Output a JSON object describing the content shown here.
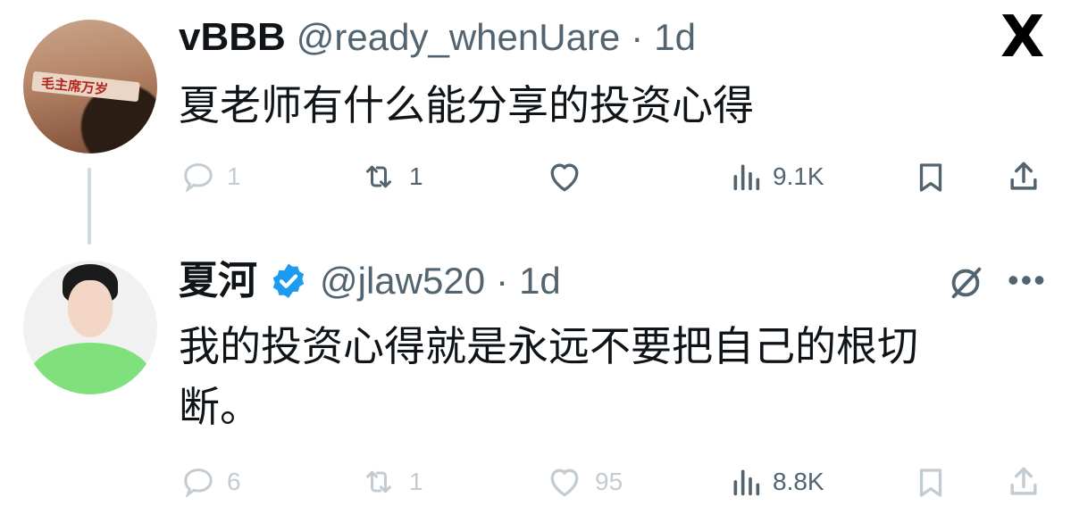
{
  "header": {
    "logo_label": "X"
  },
  "tweets": [
    {
      "name": "vBBB",
      "handle": "@ready_whenUare",
      "time": "1d",
      "avatar_banner_text": "毛主席万岁",
      "text": "夏老师有什么能分享的投资心得",
      "actions": {
        "replies": "1",
        "reposts": "1",
        "likes": "",
        "views": "9.1K"
      },
      "icons": [
        "reply-icon",
        "repost-icon",
        "like-icon",
        "views-icon",
        "bookmark-icon",
        "share-icon"
      ]
    },
    {
      "name": "夏河",
      "handle": "@jlaw520",
      "time": "1d",
      "verified": true,
      "text_line1": "我的投资心得就是永远不要把自己的根切",
      "text_line2": "断。",
      "actions": {
        "replies": "6",
        "reposts": "1",
        "likes": "95",
        "views": "8.8K"
      },
      "icons": [
        "grok-icon",
        "more-icon",
        "reply-icon",
        "repost-icon",
        "like-icon",
        "views-icon",
        "bookmark-icon",
        "share-icon"
      ]
    }
  ],
  "colors": {
    "text": "#0f1419",
    "secondary": "#536471",
    "faded": "#c2ccd2",
    "verified": "#1d9bf0",
    "thread_line": "#cfd9de"
  }
}
